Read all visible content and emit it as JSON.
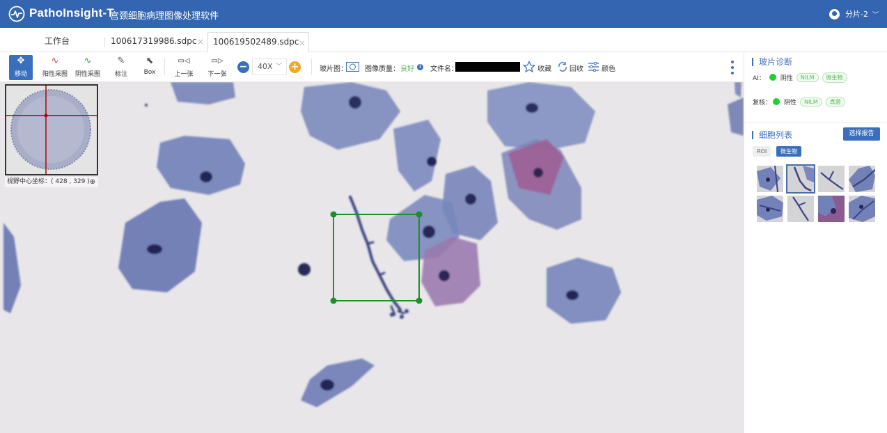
{
  "header": {
    "app_name": "PathoInsight-T",
    "subtitle": "宫颈细胞病理图像处理软件",
    "user_name": "分片-2"
  },
  "tabs": [
    {
      "label": "工作台"
    },
    {
      "label": "100617319986.sdpc"
    },
    {
      "label": "100619502489.sdpc",
      "active": true
    }
  ],
  "toolbar": {
    "move_label": "移动",
    "positive_label": "阳性采图",
    "negative_label": "阴性采图",
    "annotate_label": "标注",
    "box_label": "Box",
    "prev_label": "上一张",
    "next_label": "下一张",
    "zoom_value": "40X",
    "slide_label": "玻片图：",
    "quality_label": "图像质量：",
    "quality_value": "良好",
    "filename_label": "文件名：",
    "favorite_label": "收藏",
    "recycle_label": "回收",
    "color_label": "颜色"
  },
  "minimap": {
    "coord_text": "视野中心坐标：( 428 , 329 )"
  },
  "panel": {
    "diagnosis_title": "玻片诊断",
    "ai_label": "AI：",
    "ai_result": "阴性",
    "ai_tags": [
      "NILM",
      "微生物"
    ],
    "review_label": "复核：",
    "review_result": "阴性",
    "review_tags": [
      "NILM",
      "真菌"
    ],
    "cell_list_title": "细胞列表",
    "select_report_label": "选择报告",
    "filter_roi": "ROI",
    "filter_micro": "微生物"
  },
  "colors": {
    "brand": "#3465b0",
    "accent": "#3a6fbd",
    "status_green": "#1dd334",
    "roi_box": "#1e8f28"
  }
}
